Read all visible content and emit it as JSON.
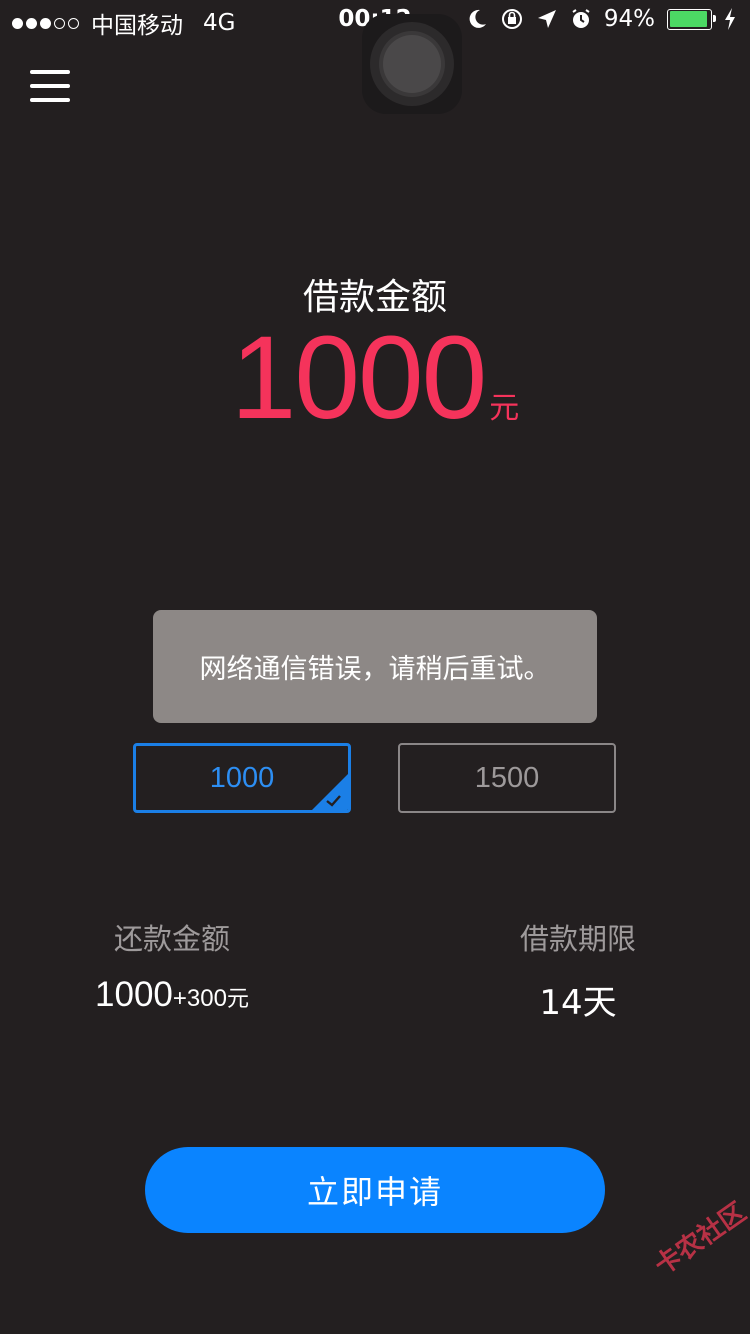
{
  "status_bar": {
    "carrier": "中国移动",
    "network": "4G",
    "time": "00:12",
    "battery": "94%",
    "battery_level": 0.94,
    "signal_bars": 3,
    "signal_total": 5
  },
  "header": {
    "loan_label": "借款金额",
    "amount": "1000",
    "amount_unit": "元"
  },
  "toast": {
    "message": "网络通信错误，请稍后重试。"
  },
  "options": [
    {
      "label": "1000",
      "selected": true
    },
    {
      "label": "1500",
      "selected": false
    }
  ],
  "repay": {
    "label": "还款金额",
    "principal": "1000",
    "fee": "+300",
    "unit": "元"
  },
  "term": {
    "label": "借款期限",
    "value": "14天"
  },
  "apply_button": {
    "label": "立即申请"
  },
  "watermark": {
    "text": "卡农社区"
  },
  "colors": {
    "background": "#231f20",
    "accent_amount": "#f5335b",
    "primary_blue": "#0a84ff",
    "selected_border": "#1b7fe6",
    "toast_bg": "#8d8886",
    "battery_green": "#4cd964"
  }
}
